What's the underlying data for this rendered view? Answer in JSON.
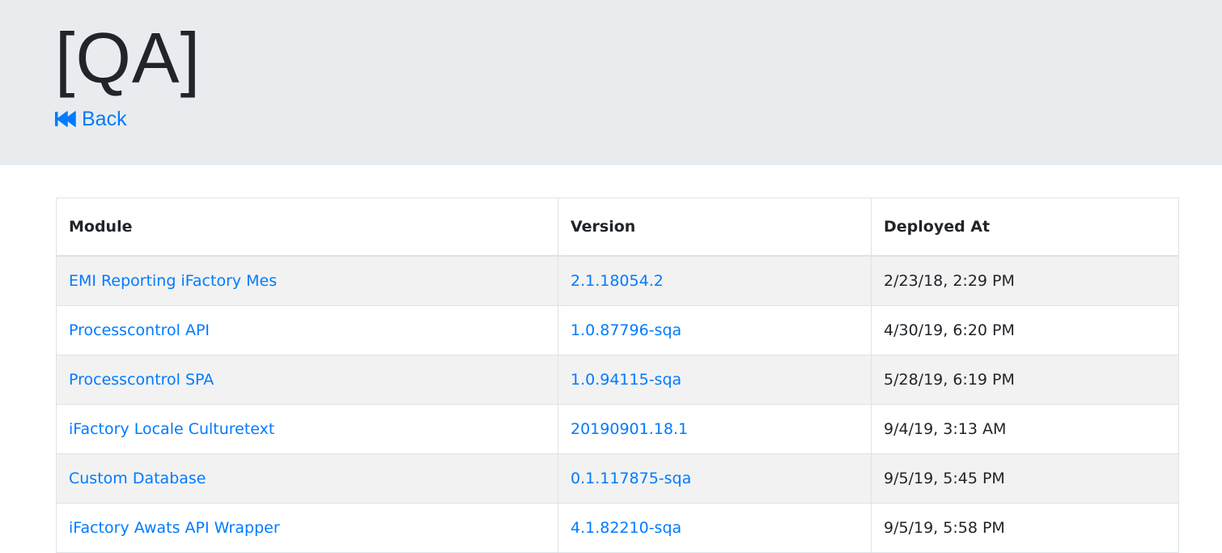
{
  "header": {
    "title": "[QA]",
    "back_label": "Back",
    "back_icon": "fast-backward-icon"
  },
  "table": {
    "columns": [
      "Module",
      "Version",
      "Deployed At"
    ],
    "rows": [
      {
        "module": "EMI Reporting iFactory Mes",
        "version": "2.1.18054.2",
        "deployed_at": "2/23/18, 2:29 PM"
      },
      {
        "module": "Processcontrol API",
        "version": "1.0.87796-sqa",
        "deployed_at": "4/30/19, 6:20 PM"
      },
      {
        "module": "Processcontrol SPA",
        "version": "1.0.94115-sqa",
        "deployed_at": "5/28/19, 6:19 PM"
      },
      {
        "module": "iFactory Locale Culturetext",
        "version": "20190901.18.1",
        "deployed_at": "9/4/19, 3:13 AM"
      },
      {
        "module": "Custom Database",
        "version": "0.1.117875-sqa",
        "deployed_at": "9/5/19, 5:45 PM"
      },
      {
        "module": "iFactory Awats API Wrapper",
        "version": "4.1.82210-sqa",
        "deployed_at": "9/5/19, 5:58 PM"
      }
    ]
  },
  "colors": {
    "link": "#007bff",
    "jumbotron_bg": "#e9ecef",
    "stripe_bg": "#f2f2f2",
    "border": "#dee2e6",
    "text": "#212529"
  }
}
